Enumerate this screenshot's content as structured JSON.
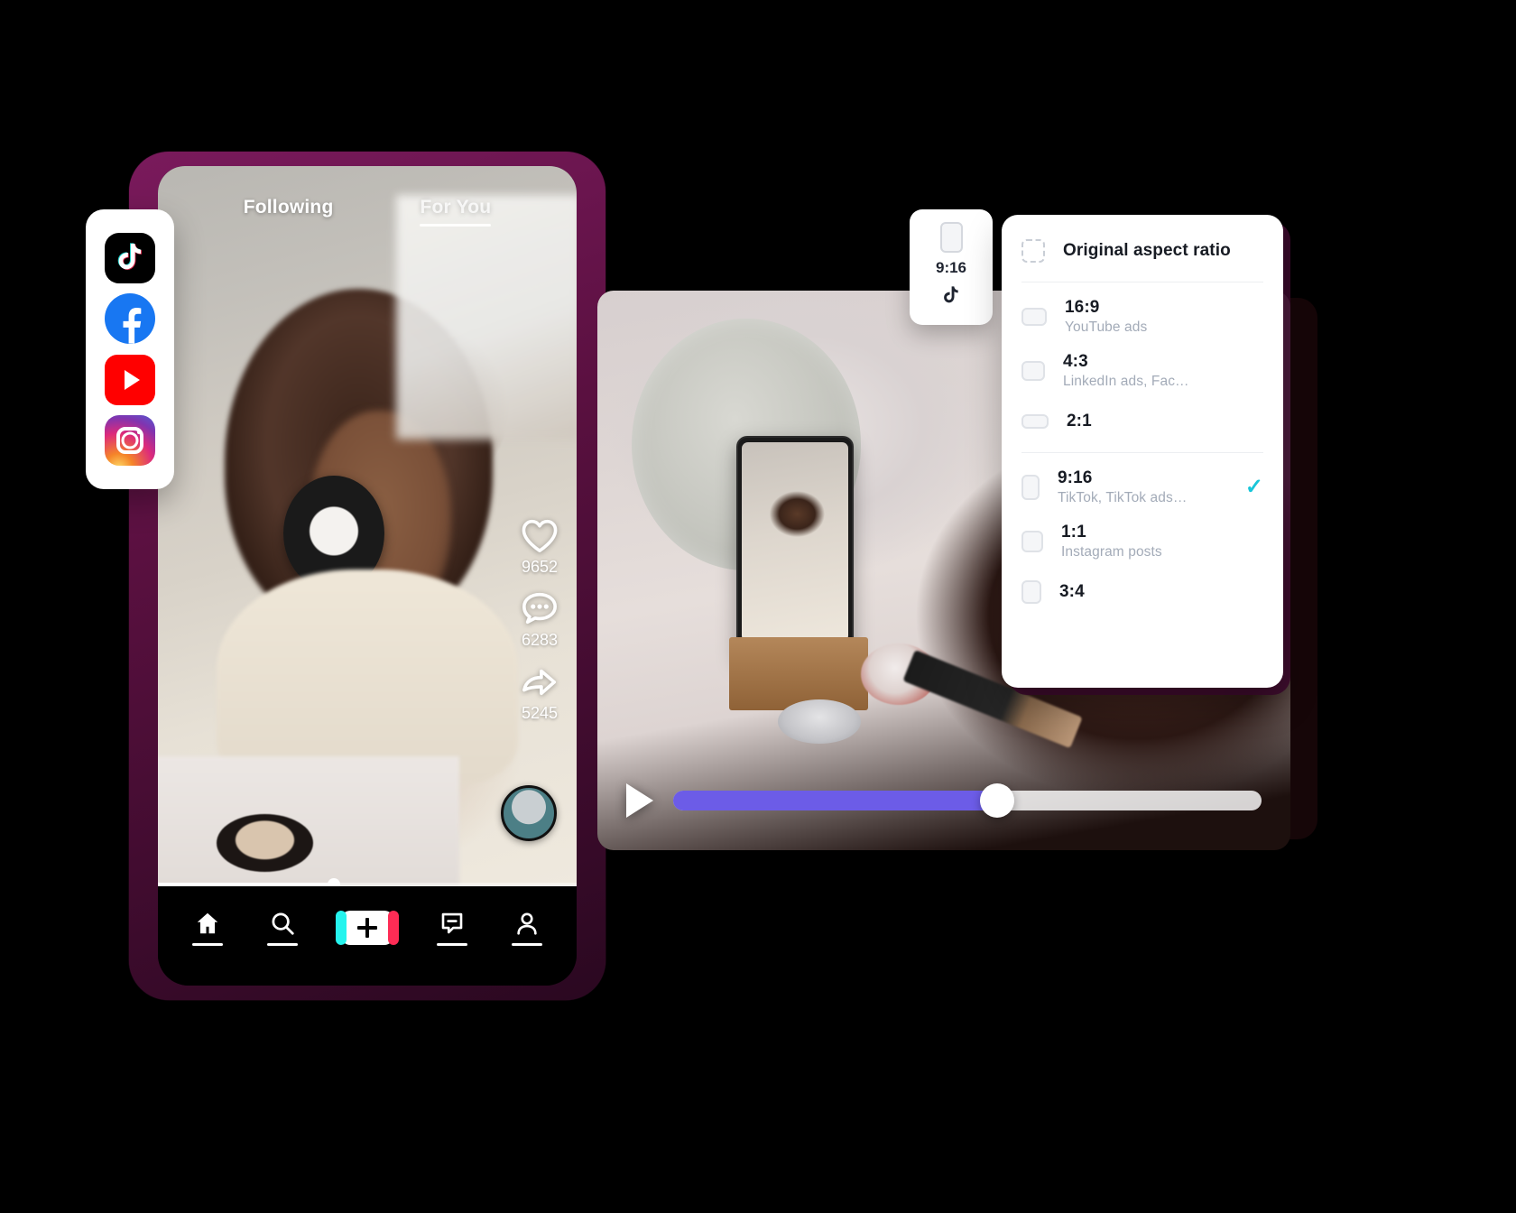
{
  "social_card": {
    "items": [
      {
        "name": "tiktok",
        "label": "TikTok"
      },
      {
        "name": "facebook",
        "label": "Facebook"
      },
      {
        "name": "youtube",
        "label": "YouTube"
      },
      {
        "name": "instagram",
        "label": "Instagram"
      }
    ]
  },
  "phone": {
    "tabs": [
      {
        "id": "following",
        "label": "Following",
        "active": true
      },
      {
        "id": "for-you",
        "label": "For You",
        "active": false
      }
    ],
    "actions": [
      {
        "icon": "heart-icon",
        "count": "9652"
      },
      {
        "icon": "comment-icon",
        "count": "6283"
      },
      {
        "icon": "share-icon",
        "count": "5245"
      }
    ],
    "nav": [
      {
        "id": "home",
        "icon": "home-icon"
      },
      {
        "id": "discover",
        "icon": "search-icon"
      },
      {
        "id": "create",
        "icon": "plus-icon"
      },
      {
        "id": "inbox",
        "icon": "inbox-icon"
      },
      {
        "id": "profile",
        "icon": "person-icon"
      }
    ],
    "scrub_percent": "42"
  },
  "editor": {
    "play_label": "Play",
    "progress_percent": "55"
  },
  "ratio_side_card": {
    "label": "9:16",
    "platform_icon": "tiktok-icon"
  },
  "ratio_menu": {
    "header": {
      "title": "Original aspect ratio",
      "icon": "dashed-frame-icon"
    },
    "groups": [
      {
        "items": [
          {
            "title": "16:9",
            "sub": "YouTube ads",
            "icon": "ratio-16-9-icon",
            "selected": false
          },
          {
            "title": "4:3",
            "sub": "LinkedIn ads, Fac…",
            "icon": "ratio-4-3-icon",
            "selected": false
          },
          {
            "title": "2:1",
            "sub": "",
            "icon": "ratio-2-1-icon",
            "selected": false
          }
        ]
      },
      {
        "items": [
          {
            "title": "9:16",
            "sub": "TikTok, TikTok ads…",
            "icon": "ratio-9-16-icon",
            "selected": true
          },
          {
            "title": "1:1",
            "sub": "Instagram posts",
            "icon": "ratio-1-1-icon",
            "selected": false
          },
          {
            "title": "3:4",
            "sub": "",
            "icon": "ratio-3-4-icon",
            "selected": false
          }
        ]
      }
    ],
    "check_glyph": "✓",
    "accent_color": "#18c6d9"
  }
}
